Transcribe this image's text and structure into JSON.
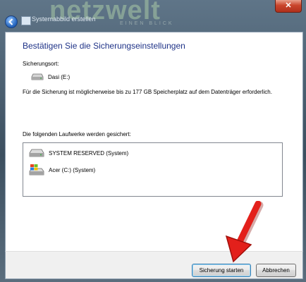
{
  "window": {
    "title": "Systemabbild erstellen",
    "close_symbol": "✕"
  },
  "watermark": {
    "brand": "netzwelt",
    "tagline": "EINEN BLICK"
  },
  "page": {
    "heading": "Bestätigen Sie die Sicherungseinstellungen",
    "location_label": "Sicherungsort:",
    "destination": {
      "name": "Dasi (E:)",
      "icon": "drive-icon"
    },
    "note": "Für die Sicherung ist möglicherweise bis zu 177 GB Speicherplatz auf dem Datenträger erforderlich.",
    "drives_label": "Die folgenden Laufwerke werden gesichert:",
    "drives": [
      {
        "name": "SYSTEM RESERVED (System)",
        "icon": "drive-icon"
      },
      {
        "name": "Acer (C:) (System)",
        "icon": "windows-drive-icon"
      }
    ]
  },
  "buttons": {
    "start": "Sicherung starten",
    "cancel": "Abbrechen"
  },
  "colors": {
    "heading": "#1e3287",
    "arrow": "#e3201b",
    "close": "#c9452c"
  }
}
